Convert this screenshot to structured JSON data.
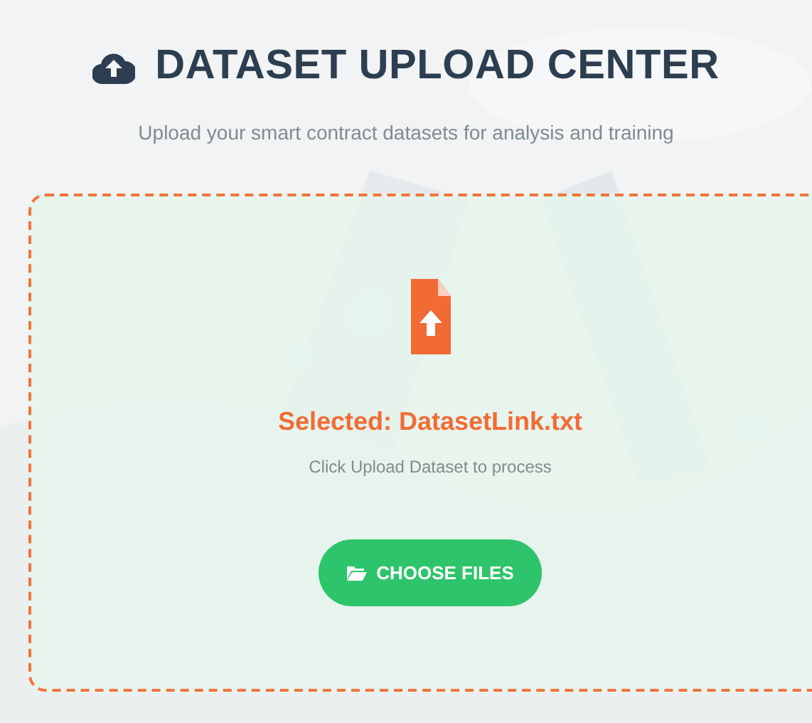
{
  "header": {
    "title": "DATASET UPLOAD CENTER",
    "subtitle": "Upload your smart contract datasets for analysis and training"
  },
  "dropzone": {
    "file_selected": true,
    "status": "Selected: DatasetLink.txt",
    "hint": "Click Upload Dataset to process",
    "button": "CHOOSE FILES"
  }
}
